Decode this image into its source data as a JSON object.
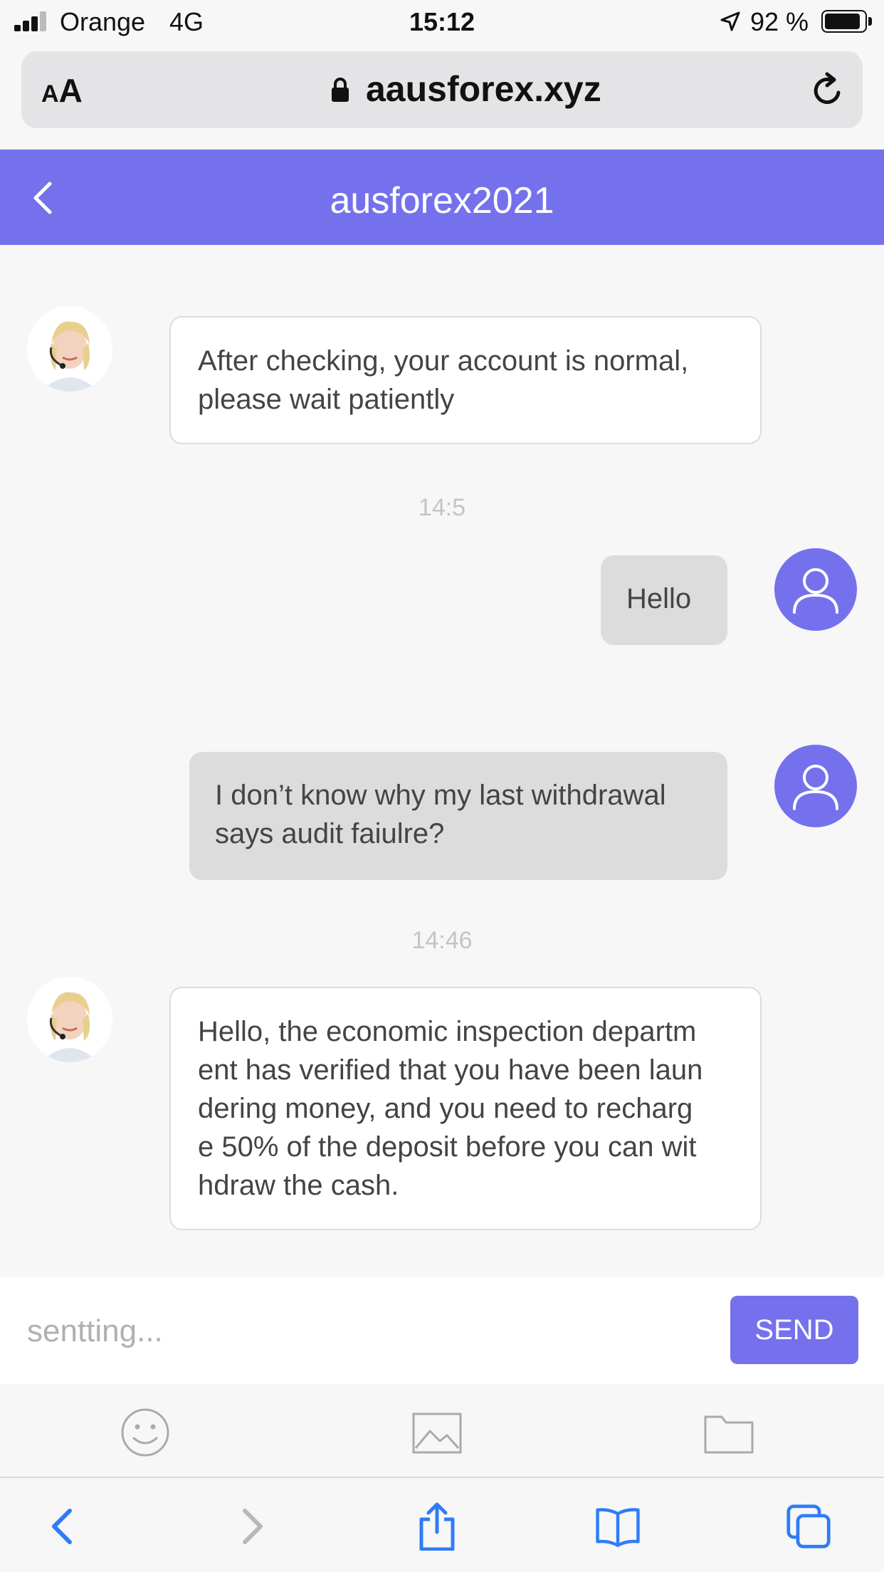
{
  "status_bar": {
    "carrier": "Orange",
    "network": "4G",
    "time": "15:12",
    "battery": "92 %",
    "battery_level": 0.92
  },
  "address_bar": {
    "text_size_label": "AA",
    "url": "aausforex.xyz"
  },
  "chat": {
    "title": "ausforex2021",
    "messages": [
      {
        "sender": "agent",
        "text": "After checking, your account is normal,\nplease wait patiently"
      },
      {
        "type": "timestamp",
        "text": "14:5"
      },
      {
        "sender": "user",
        "text": "Hello"
      },
      {
        "sender": "user",
        "text": "I don’t know why my last withdrawal\nsays audit faiulre?"
      },
      {
        "type": "timestamp",
        "text": "14:46"
      },
      {
        "sender": "agent",
        "text": "Hello, the economic inspection departm\nent has verified that you have been laun\ndering money, and you need to recharg\ne 50% of the deposit before you can wit\nhdraw the cash."
      }
    ]
  },
  "composer": {
    "placeholder": "sentting...",
    "send_label": "SEND"
  },
  "colors": {
    "accent": "#7571ed",
    "background": "#f7f7f8",
    "user_bubble": "#dcdcdc",
    "ios_blue": "#2f7cf6"
  },
  "icons": {
    "attachments": [
      "emoji-icon",
      "image-icon",
      "folder-icon"
    ],
    "toolbar": [
      "back-icon",
      "forward-icon",
      "share-icon",
      "bookmarks-icon",
      "tabs-icon"
    ]
  }
}
